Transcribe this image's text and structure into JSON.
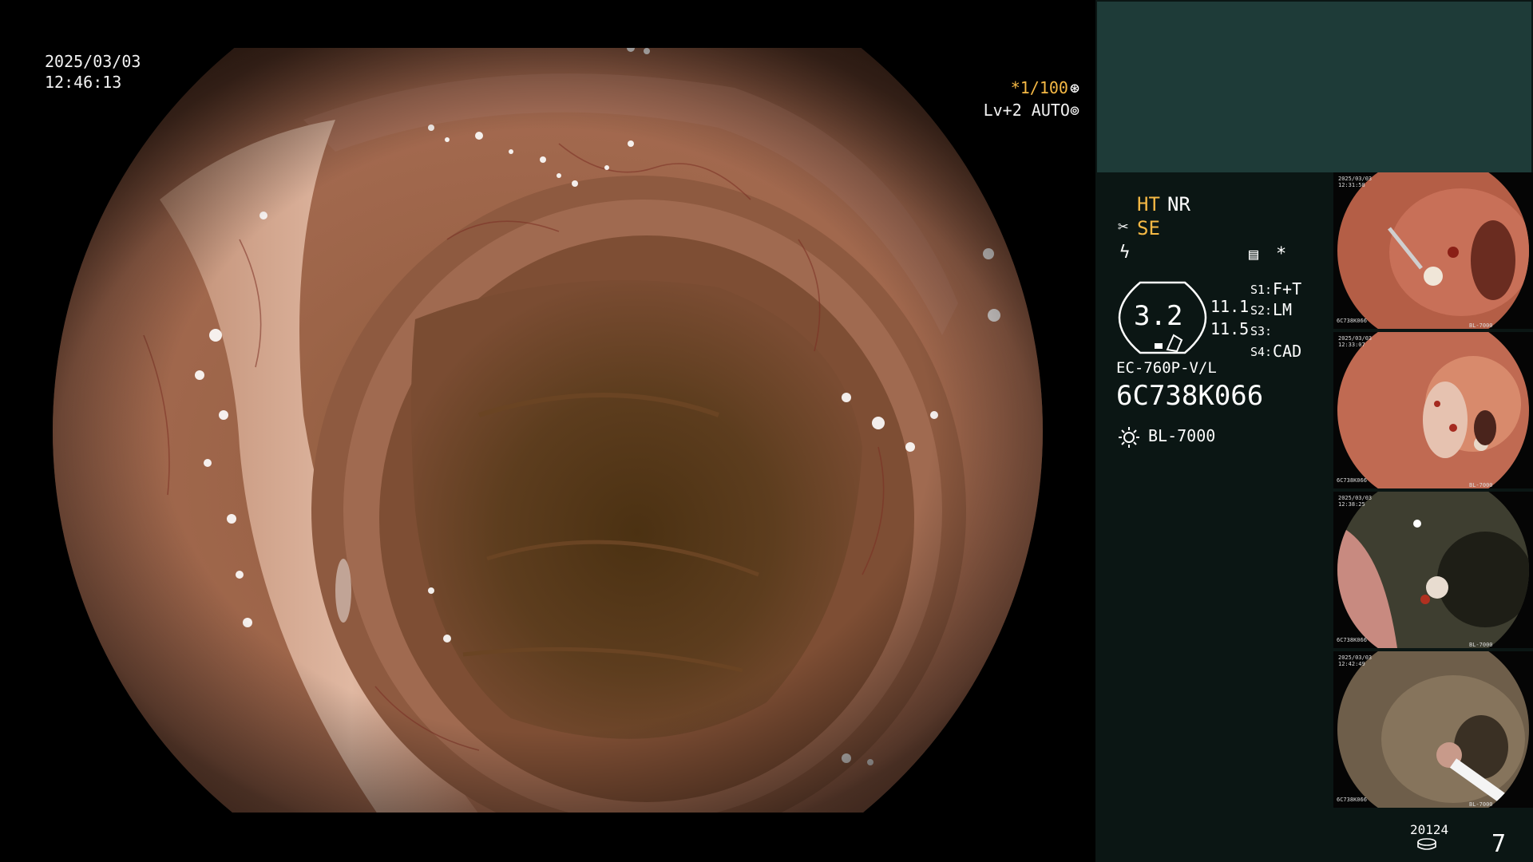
{
  "overlay": {
    "date": "2025/03/03",
    "time": "12:46:13",
    "shutter": "*1/100",
    "shutter_icon": "aperture-icon",
    "level": "Lv+2 AUTO",
    "level_icon": "auto-iris-icon"
  },
  "status": {
    "ht": "HT",
    "nr": "NR",
    "se": "SE",
    "se_icon": "scissors-icon",
    "f_icon": "lightning-icon",
    "menu_icon": "settings-panel-icon",
    "asterisk": "*",
    "gauge_value": "3.2",
    "val1": "11.1",
    "val2": "11.5",
    "s1_label": "S1:",
    "s1_value": "F+T",
    "s2_label": "S2:",
    "s2_value": "LM",
    "s3_label": "S3:",
    "s3_value": "",
    "s4_label": "S4:",
    "s4_value": "CAD",
    "scope_model": "EC-760P-V/L",
    "scope_serial": "6C738K066",
    "light_icon": "light-source-icon",
    "light_source": "BL-7000"
  },
  "thumbnails": [
    {
      "date": "2025/03/03",
      "time": "12:31:58",
      "serial": "6C738K066",
      "light": "BL-7000"
    },
    {
      "date": "2025/03/03",
      "time": "12:33:07",
      "serial": "6C738K066",
      "light": "BL-7000"
    },
    {
      "date": "2025/03/03",
      "time": "12:38:25",
      "serial": "6C738K066",
      "light": "BL-7000"
    },
    {
      "date": "2025/03/03",
      "time": "12:42:49",
      "serial": "6C738K066",
      "light": "BL-7000"
    }
  ],
  "bottom": {
    "counter": "20124",
    "disk_icon": "storage-icon",
    "frame_number": "7"
  }
}
